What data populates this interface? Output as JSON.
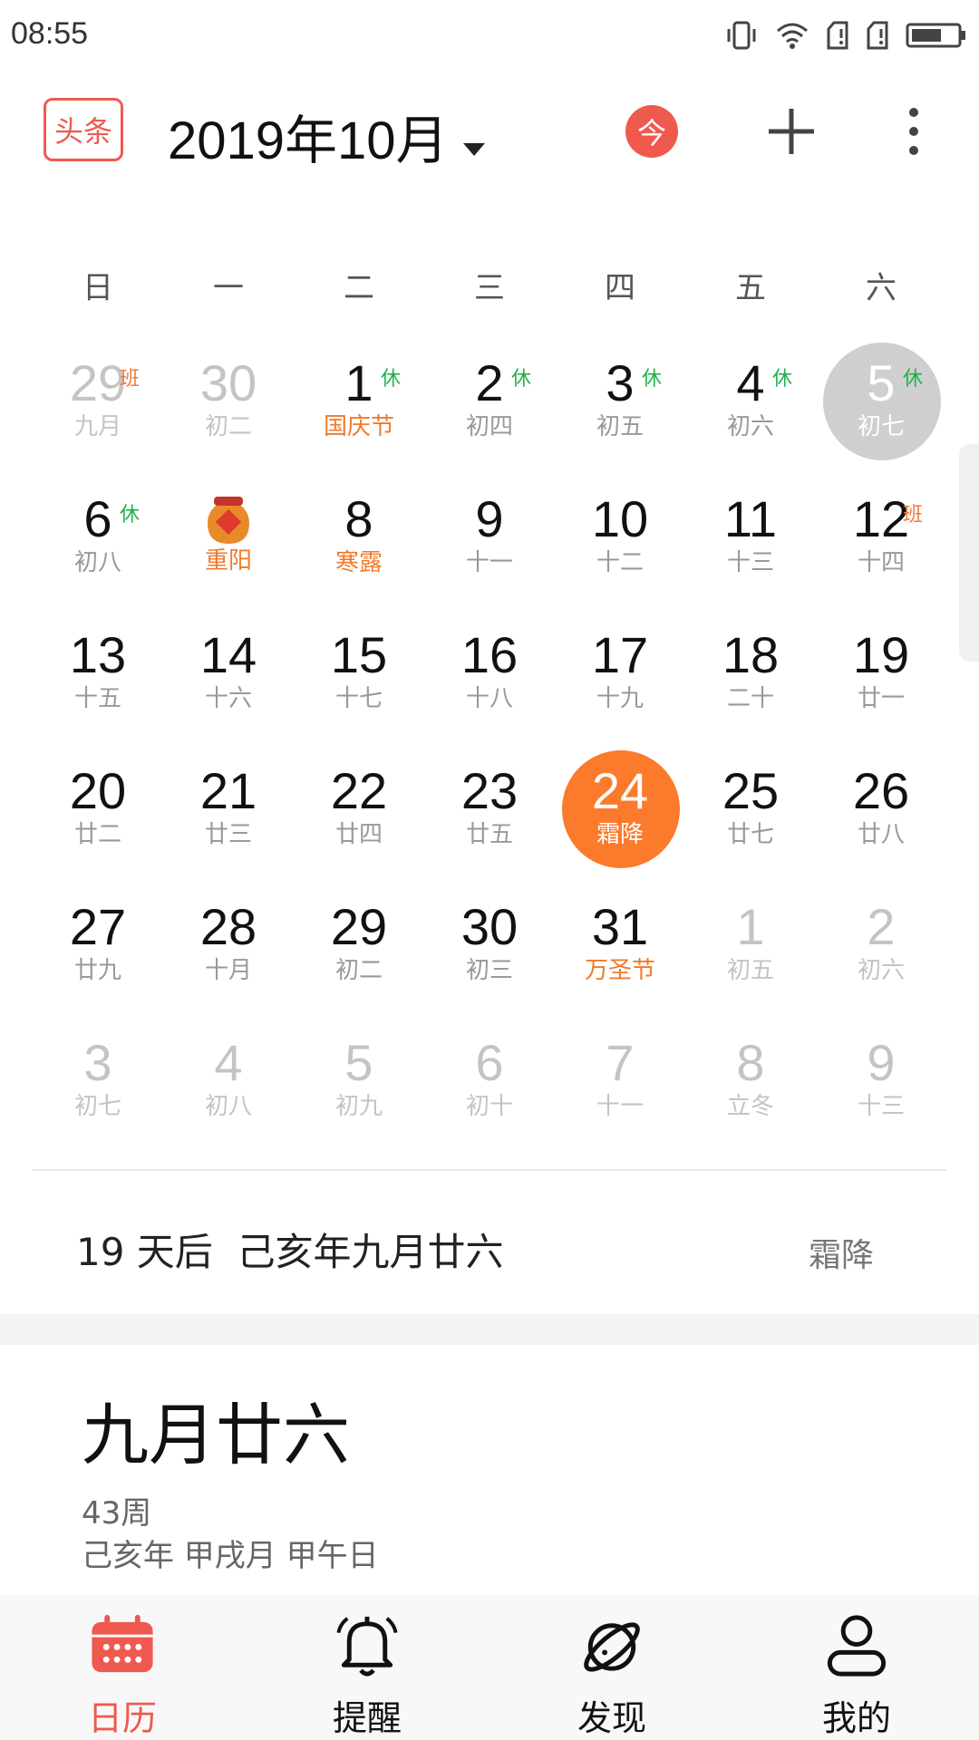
{
  "status_bar": {
    "time": "08:55",
    "icons": [
      "vibrate-icon",
      "wifi-icon",
      "sim1-icon",
      "sim2-icon",
      "battery-icon"
    ]
  },
  "header": {
    "toutiao_label": "头条",
    "month_title": "2019年10月",
    "today_label": "今",
    "add_icon": "plus-icon",
    "more_icon": "more-vertical-icon"
  },
  "weekdays": [
    "日",
    "一",
    "二",
    "三",
    "四",
    "五",
    "六"
  ],
  "weeks": [
    [
      {
        "day": "29",
        "lunar": "九月",
        "tag": "班",
        "tag_type": "work",
        "other": true
      },
      {
        "day": "30",
        "lunar": "初二",
        "other": true
      },
      {
        "day": "1",
        "lunar": "国庆节",
        "tag": "休",
        "tag_type": "rest",
        "festival": true
      },
      {
        "day": "2",
        "lunar": "初四",
        "tag": "休",
        "tag_type": "rest"
      },
      {
        "day": "3",
        "lunar": "初五",
        "tag": "休",
        "tag_type": "rest"
      },
      {
        "day": "4",
        "lunar": "初六",
        "tag": "休",
        "tag_type": "rest"
      },
      {
        "day": "5",
        "lunar": "初七",
        "tag": "休",
        "tag_type": "rest",
        "selected": true
      }
    ],
    [
      {
        "day": "6",
        "lunar": "初八",
        "tag": "休",
        "tag_type": "rest"
      },
      {
        "day": "",
        "lunar": "重阳",
        "festival": true,
        "icon": "wine-jar-icon"
      },
      {
        "day": "8",
        "lunar": "寒露",
        "festival": true
      },
      {
        "day": "9",
        "lunar": "十一"
      },
      {
        "day": "10",
        "lunar": "十二"
      },
      {
        "day": "11",
        "lunar": "十三"
      },
      {
        "day": "12",
        "lunar": "十四",
        "tag": "班",
        "tag_type": "work"
      }
    ],
    [
      {
        "day": "13",
        "lunar": "十五"
      },
      {
        "day": "14",
        "lunar": "十六"
      },
      {
        "day": "15",
        "lunar": "十七"
      },
      {
        "day": "16",
        "lunar": "十八"
      },
      {
        "day": "17",
        "lunar": "十九"
      },
      {
        "day": "18",
        "lunar": "二十"
      },
      {
        "day": "19",
        "lunar": "廿一"
      }
    ],
    [
      {
        "day": "20",
        "lunar": "廿二"
      },
      {
        "day": "21",
        "lunar": "廿三"
      },
      {
        "day": "22",
        "lunar": "廿四"
      },
      {
        "day": "23",
        "lunar": "廿五"
      },
      {
        "day": "24",
        "lunar": "霜降",
        "today": true
      },
      {
        "day": "25",
        "lunar": "廿七"
      },
      {
        "day": "26",
        "lunar": "廿八"
      }
    ],
    [
      {
        "day": "27",
        "lunar": "廿九"
      },
      {
        "day": "28",
        "lunar": "十月"
      },
      {
        "day": "29",
        "lunar": "初二"
      },
      {
        "day": "30",
        "lunar": "初三"
      },
      {
        "day": "31",
        "lunar": "万圣节",
        "festival": true
      },
      {
        "day": "1",
        "lunar": "初五",
        "other": true
      },
      {
        "day": "2",
        "lunar": "初六",
        "other": true
      }
    ],
    [
      {
        "day": "3",
        "lunar": "初七",
        "other": true
      },
      {
        "day": "4",
        "lunar": "初八",
        "other": true
      },
      {
        "day": "5",
        "lunar": "初九",
        "other": true
      },
      {
        "day": "6",
        "lunar": "初十",
        "other": true
      },
      {
        "day": "7",
        "lunar": "十一",
        "other": true
      },
      {
        "day": "8",
        "lunar": "立冬",
        "other": true
      },
      {
        "day": "9",
        "lunar": "十三",
        "other": true
      }
    ]
  ],
  "info": {
    "countdown": "19 天后",
    "lunar_date": "己亥年九月廿六",
    "solar_term": "霜降"
  },
  "detail": {
    "lunar_big": "九月廿六",
    "week_number": "43周",
    "ganzhi": "己亥年 甲戌月 甲午日"
  },
  "bottom_nav": [
    {
      "label": "日历",
      "icon": "calendar-icon",
      "active": true
    },
    {
      "label": "提醒",
      "icon": "bell-icon",
      "active": false
    },
    {
      "label": "发现",
      "icon": "planet-icon",
      "active": false
    },
    {
      "label": "我的",
      "icon": "user-icon",
      "active": false
    }
  ],
  "colors": {
    "accent_red": "#ee5a50",
    "today_orange": "#fb7a2c",
    "festival_orange": "#f07a2a",
    "rest_green": "#22b14c"
  }
}
